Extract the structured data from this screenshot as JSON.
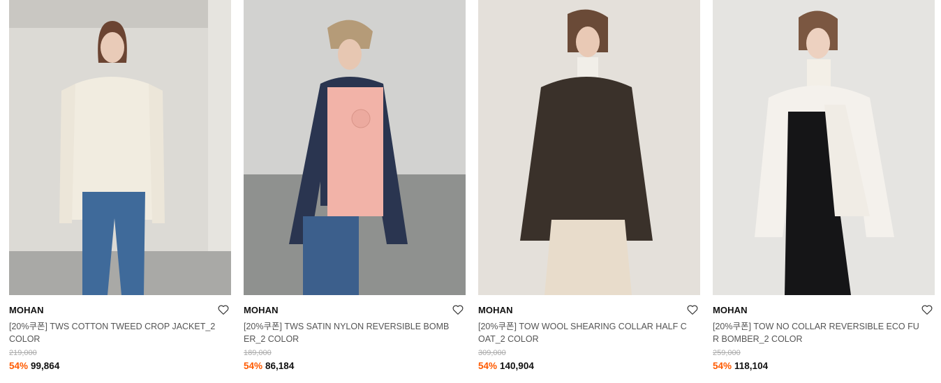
{
  "products": [
    {
      "brand": "MOHAN",
      "name": "[20%쿠폰] TWS COTTON TWEED CROP JACKET_2 COLOR",
      "original_price": "219,000",
      "discount": "54%",
      "price": "99,864",
      "garment": "cream-tweed-jacket"
    },
    {
      "brand": "MOHAN",
      "name": "[20%쿠폰] TWS SATIN NYLON REVERSIBLE BOMBER_2 COLOR",
      "original_price": "189,000",
      "discount": "54%",
      "price": "86,184",
      "garment": "pink-navy-bomber"
    },
    {
      "brand": "MOHAN",
      "name": "[20%쿠폰] TOW WOOL SHEARING COLLAR HALF COAT_2 COLOR",
      "original_price": "309,000",
      "discount": "54%",
      "price": "140,904",
      "garment": "brown-shearling-coat"
    },
    {
      "brand": "MOHAN",
      "name": "[20%쿠폰] TOW NO COLLAR REVERSIBLE ECO FUR BOMBER_2 COLOR",
      "original_price": "259,000",
      "discount": "54%",
      "price": "118,104",
      "garment": "white-fur-bomber"
    }
  ],
  "icons": {
    "wishlist": "heart-outline-icon"
  },
  "colors": {
    "discount": "#ff5a00",
    "brand_text": "#111111",
    "name_text": "#555555",
    "strike_text": "#aaaaaa"
  }
}
